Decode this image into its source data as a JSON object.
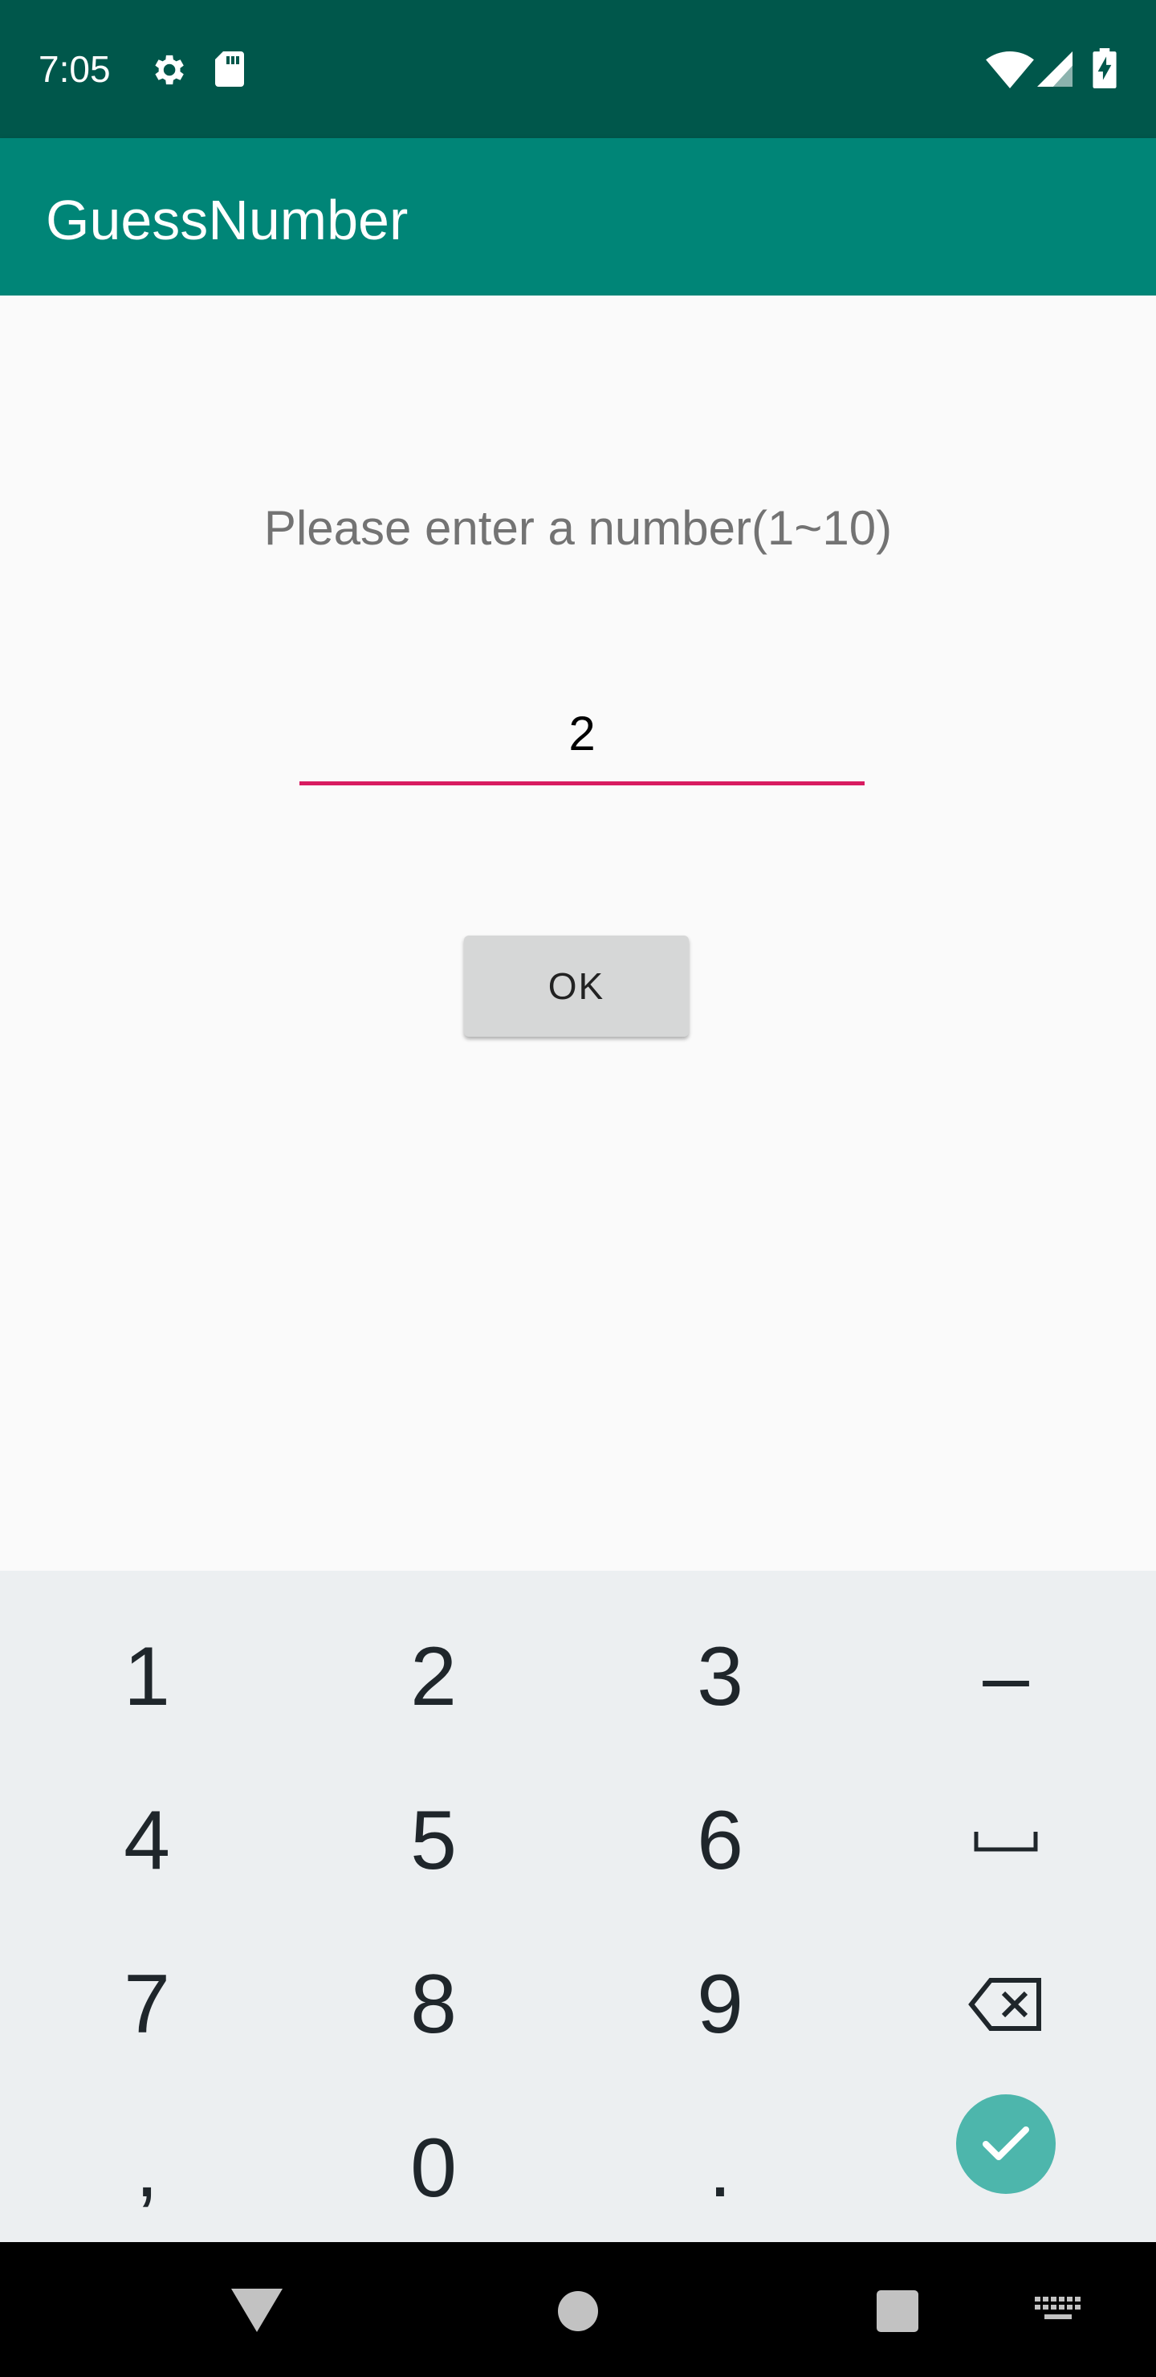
{
  "status_bar": {
    "time": "7:05",
    "icons": [
      "settings-icon",
      "sd-card-icon",
      "wifi-icon",
      "cell-signal-icon",
      "battery-charging-icon"
    ]
  },
  "app_bar": {
    "title": "GuessNumber"
  },
  "main": {
    "prompt": "Please enter a number(1~10)",
    "number_input": {
      "value": "2"
    },
    "ok_label": "OK"
  },
  "keyboard": {
    "rows": [
      [
        "1",
        "2",
        "3",
        "–"
      ],
      [
        "4",
        "5",
        "6",
        "space"
      ],
      [
        "7",
        "8",
        "9",
        "backspace"
      ],
      [
        ",",
        "0",
        ".",
        "done"
      ]
    ],
    "accent_color": "#4db6ac"
  },
  "nav_bar": {
    "buttons": [
      "back-icon",
      "home-icon",
      "recents-icon",
      "keyboard-switch-icon"
    ]
  },
  "colors": {
    "status_bar": "#00574b",
    "app_bar": "#008577",
    "input_underline": "#d81b60"
  }
}
